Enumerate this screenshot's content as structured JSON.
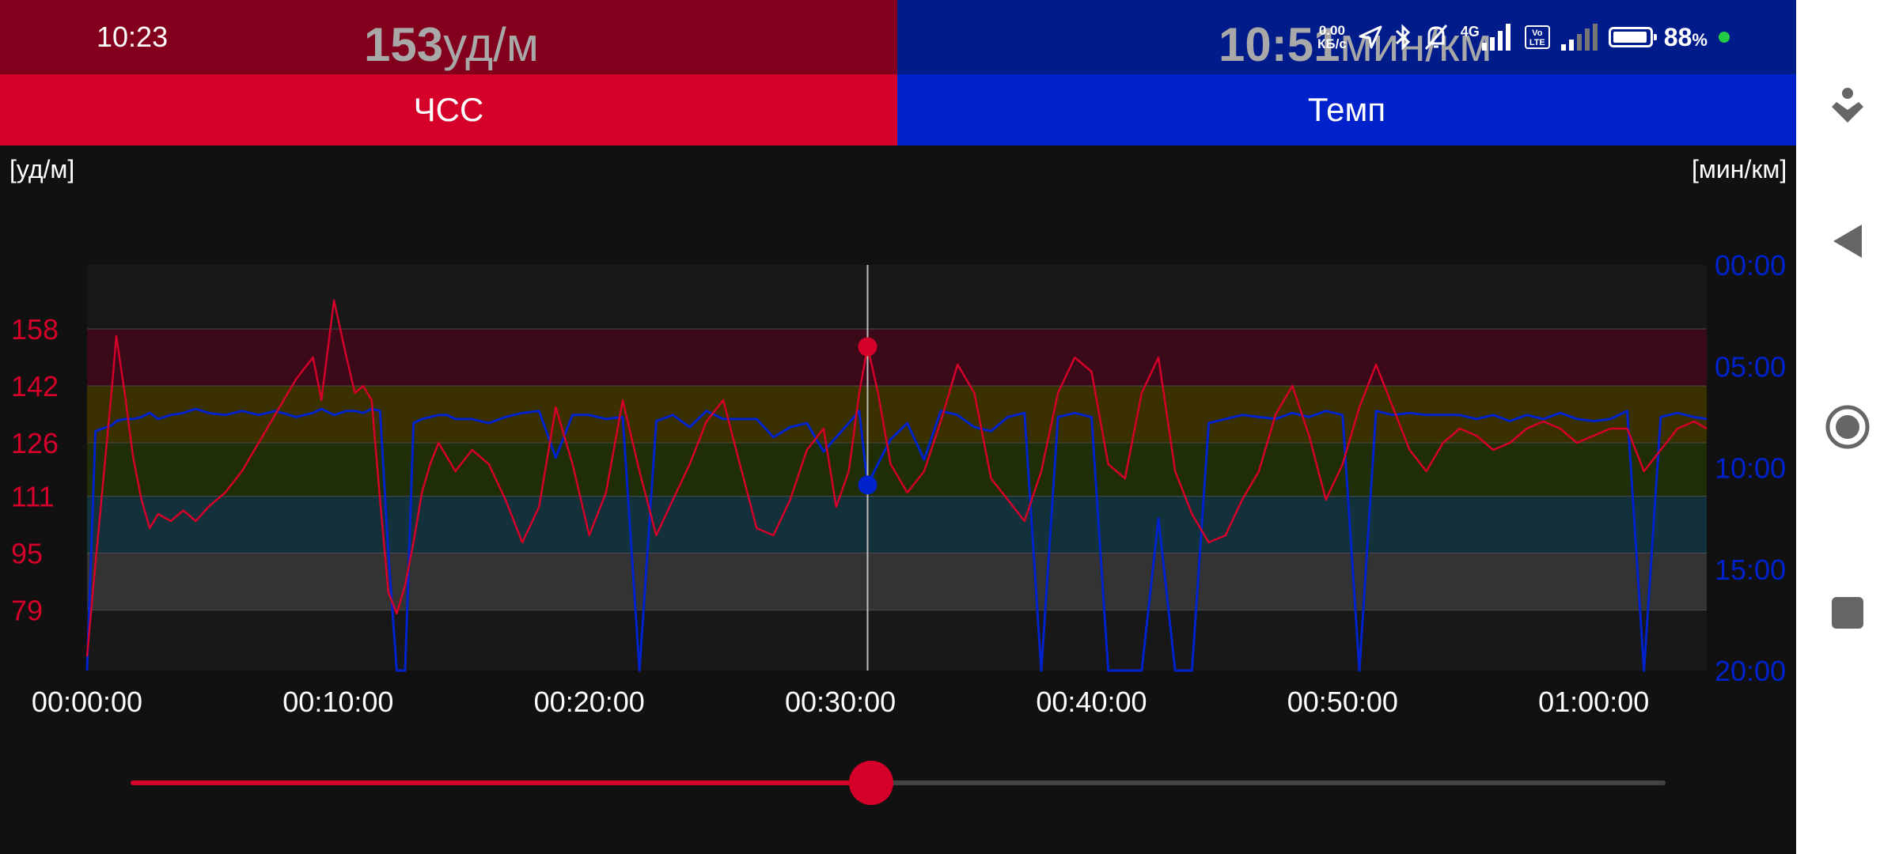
{
  "status_bar": {
    "time": "10:23",
    "net_speed_value": "0.00",
    "net_speed_unit": "КБ/с",
    "network": "4G",
    "volte_top": "Vo",
    "volte_bottom": "LTE",
    "battery": "88",
    "battery_unit": "%"
  },
  "header": {
    "hr_value": "153",
    "hr_unit": "уд/м",
    "pace_value": "10:51",
    "pace_unit": "мин/км"
  },
  "tabs": {
    "hr_label": "ЧСС",
    "pace_label": "Темп"
  },
  "colors": {
    "hr": "#d4002a",
    "pace": "#0022cc",
    "hr_header_bg": "#82001c",
    "pace_header_bg": "#001b8a",
    "zone_5": "#3a0a18",
    "zone_4": "#3a3000",
    "zone_3": "#1f2e06",
    "zone_2": "#13313a",
    "zone_1": "#333333",
    "plot_bg": "#181818"
  },
  "chart_data": {
    "type": "line",
    "x_unit": "seconds",
    "x_range": [
      0,
      3870
    ],
    "x_tick_labels": [
      "00:00:00",
      "00:10:00",
      "00:20:00",
      "00:30:00",
      "00:40:00",
      "00:50:00",
      "01:00:00"
    ],
    "left_axis": {
      "unit_label": "[уд/м]",
      "range": [
        62,
        176
      ],
      "tick_values": [
        158,
        142,
        126,
        111,
        95,
        79
      ],
      "tick_labels": [
        "158",
        "142",
        "126",
        "111",
        "95",
        "79"
      ]
    },
    "right_axis": {
      "unit_label": "[мин/км]",
      "range_minutes": [
        0,
        20
      ],
      "tick_labels": [
        "00:00",
        "05:00",
        "10:00",
        "15:00",
        "20:00"
      ],
      "inverted": true
    },
    "zones": [
      {
        "name": "zone-5",
        "from": 142,
        "to": 158
      },
      {
        "name": "zone-4",
        "from": 126,
        "to": 142
      },
      {
        "name": "zone-3",
        "from": 111,
        "to": 126
      },
      {
        "name": "zone-2",
        "from": 95,
        "to": 111
      },
      {
        "name": "zone-1",
        "from": 79,
        "to": 95
      }
    ],
    "cursor": {
      "time_seconds": 1865,
      "hr": 153,
      "pace_minutes": 10.85
    },
    "series": [
      {
        "points_time_s": [
          0,
          20,
          60,
          70,
          90,
          110,
          130,
          150,
          170,
          200,
          230,
          260,
          290,
          330,
          370,
          410,
          450,
          500,
          540,
          560,
          590,
          620,
          640,
          660,
          680,
          700,
          720,
          740,
          760,
          780,
          800,
          820,
          840,
          860,
          880,
          920,
          960,
          1000,
          1040,
          1080,
          1120,
          1160,
          1200,
          1240,
          1280,
          1320,
          1360,
          1400,
          1440,
          1480,
          1520,
          1560,
          1600,
          1640,
          1680,
          1720,
          1760,
          1790,
          1820,
          1845,
          1865,
          1890,
          1920,
          1960,
          2000,
          2040,
          2080,
          2120,
          2160,
          2200,
          2240,
          2280,
          2320,
          2360,
          2400,
          2440,
          2480,
          2520,
          2560,
          2600,
          2640,
          2680,
          2720,
          2760,
          2800,
          2840,
          2880,
          2920,
          2960,
          3000,
          3040,
          3080,
          3120,
          3160,
          3200,
          3240,
          3280,
          3320,
          3360,
          3400,
          3440,
          3480,
          3520,
          3560,
          3600,
          3640,
          3680,
          3720,
          3760,
          3800,
          3840,
          3870
        ],
        "hr_values": [
          66,
          92,
          142,
          156,
          140,
          122,
          110,
          102,
          106,
          104,
          107,
          104,
          108,
          112,
          118,
          126,
          134,
          144,
          150,
          138,
          166,
          150,
          140,
          142,
          138,
          110,
          84,
          78,
          86,
          98,
          112,
          120,
          126,
          122,
          118,
          124,
          120,
          110,
          98,
          108,
          136,
          120,
          100,
          112,
          138,
          118,
          100,
          110,
          120,
          132,
          138,
          120,
          102,
          100,
          110,
          124,
          130,
          108,
          118,
          140,
          153,
          140,
          120,
          112,
          118,
          132,
          148,
          140,
          116,
          110,
          104,
          118,
          140,
          150,
          146,
          120,
          116,
          140,
          150,
          118,
          106,
          98,
          100,
          110,
          118,
          134,
          142,
          128,
          110,
          120,
          136,
          148,
          136,
          124,
          118,
          126,
          130,
          128,
          124,
          126,
          130,
          132,
          130,
          126,
          128,
          130,
          130,
          118,
          124,
          130,
          132,
          130,
          126,
          124
        ],
        "pace_minutes": [
          20.0,
          8.2,
          7.9,
          7.7,
          7.6,
          7.6,
          7.5,
          7.3,
          7.6,
          7.4,
          7.3,
          7.1,
          7.3,
          7.4,
          7.2,
          7.4,
          7.2,
          7.5,
          7.3,
          7.1,
          7.4,
          7.2,
          7.2,
          7.3,
          7.1,
          7.2,
          14.2,
          20.0,
          20.0,
          7.8,
          7.6,
          7.5,
          7.4,
          7.4,
          7.6,
          7.6,
          7.8,
          7.5,
          7.3,
          7.2,
          9.5,
          7.4,
          7.4,
          7.6,
          7.5,
          20.0,
          7.7,
          7.4,
          8.0,
          7.2,
          7.6,
          7.6,
          7.6,
          8.5,
          8.0,
          7.8,
          9.2,
          8.5,
          7.8,
          7.2,
          10.85,
          9.8,
          8.6,
          7.8,
          9.6,
          7.2,
          7.4,
          8.0,
          8.2,
          7.5,
          7.3,
          20.0,
          7.5,
          7.3,
          7.5,
          20.0,
          20.0,
          20.0,
          12.5,
          20.0,
          20.0,
          7.8,
          7.6,
          7.4,
          7.5,
          7.6,
          7.3,
          7.5,
          7.2,
          7.4,
          20.0,
          7.2,
          7.4,
          7.3,
          7.4,
          7.4,
          7.4,
          7.6,
          7.4,
          7.7,
          7.4,
          7.6,
          7.3,
          7.6,
          7.7,
          7.6,
          7.2,
          20.0,
          7.5,
          7.3,
          7.5,
          7.6,
          7.6,
          14.0
        ]
      }
    ]
  },
  "slider": {
    "progress_fraction": 0.4825
  },
  "nav": {
    "assist_icon": "accessibility-icon",
    "back_icon": "back-triangle-icon",
    "home_icon": "home-circle-icon",
    "recents_icon": "recents-square-icon"
  }
}
